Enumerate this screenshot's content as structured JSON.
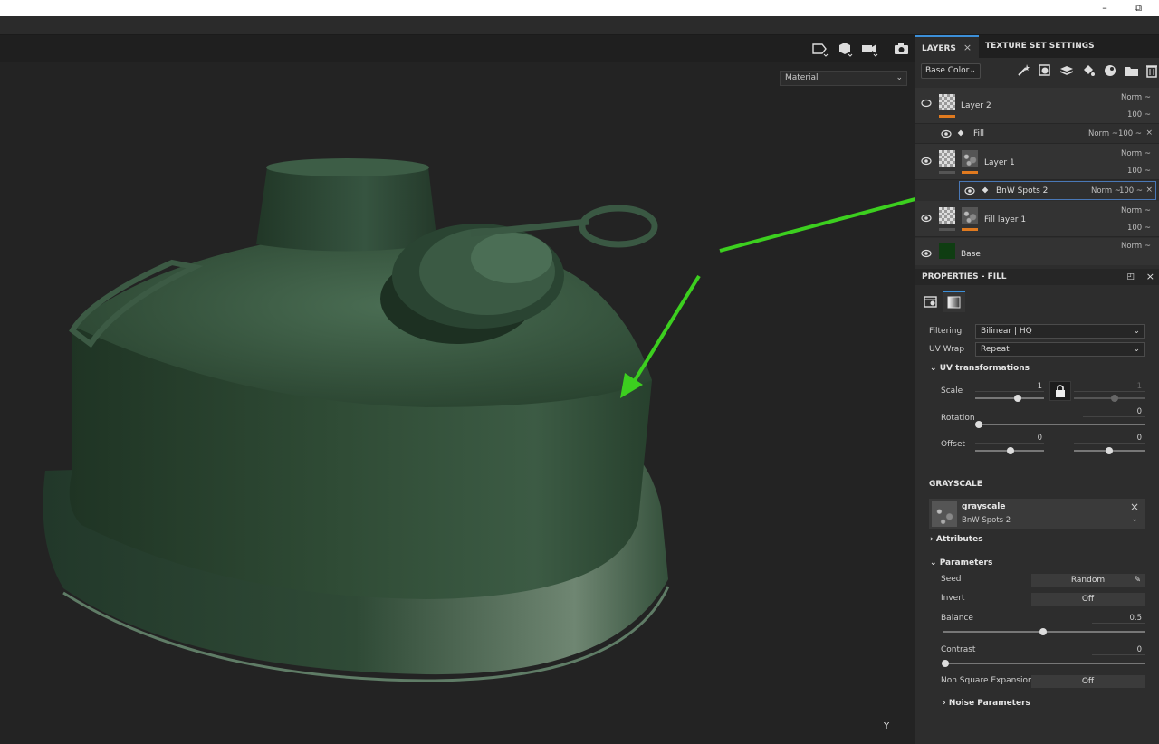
{
  "window": {
    "minimize_glyph": "–",
    "restore_glyph": "⧉"
  },
  "viewport": {
    "material_mode": "Material",
    "axis_label": "Y"
  },
  "layers_tab": {
    "label": "LAYERS",
    "close": "×"
  },
  "texture_tab": {
    "label": "TEXTURE SET SETTINGS"
  },
  "channel_select": {
    "value": "Base Color"
  },
  "layer_toolbar_icons": [
    "wand-icon",
    "mask-icon",
    "add-layer-icon",
    "add-fill-icon",
    "smart-material-icon",
    "add-folder-icon",
    "delete-icon"
  ],
  "layers": [
    {
      "name": "Layer 2",
      "blend": "Norm ~",
      "opacity": "100 ~"
    },
    {
      "name": "Fill",
      "blend": "Norm ~",
      "opacity": "100 ~",
      "close": "×"
    },
    {
      "name": "Layer 1",
      "blend": "Norm ~",
      "opacity": "100 ~"
    },
    {
      "name": "BnW Spots 2",
      "blend": "Norm ~",
      "opacity": "100 ~",
      "close": "×"
    },
    {
      "name": "Fill layer 1",
      "blend": "Norm ~",
      "opacity": "100 ~"
    },
    {
      "name": "Base",
      "blend": "Norm ~"
    }
  ],
  "properties": {
    "title": "PROPERTIES - FILL",
    "filtering_label": "Filtering",
    "filtering_value": "Bilinear | HQ",
    "uvwrap_label": "UV Wrap",
    "uvwrap_value": "Repeat",
    "uv_section": "UV transformations",
    "scale_label": "Scale",
    "scale_value": "1",
    "scale_value2": "1",
    "rotation_label": "Rotation",
    "rotation_value": "0",
    "offset_label": "Offset",
    "offset_value": "0",
    "offset_value2": "0",
    "grayscale_section": "GRAYSCALE",
    "grayscale_title": "grayscale",
    "grayscale_source": "BnW Spots 2",
    "attributes_section": "Attributes",
    "parameters_section": "Parameters",
    "seed_label": "Seed",
    "seed_value": "Random",
    "invert_label": "Invert",
    "invert_value": "Off",
    "balance_label": "Balance",
    "balance_value": "0.5",
    "contrast_label": "Contrast",
    "contrast_value": "0",
    "nse_label": "Non Square Expansion",
    "nse_value": "Off",
    "noise_section": "Noise Parameters"
  },
  "colors": {
    "accent": "#3c8fd8",
    "layer_marker": "#e07a1f",
    "annotation_arrow": "#3ccf1f",
    "model_green": "#2e4a33"
  }
}
